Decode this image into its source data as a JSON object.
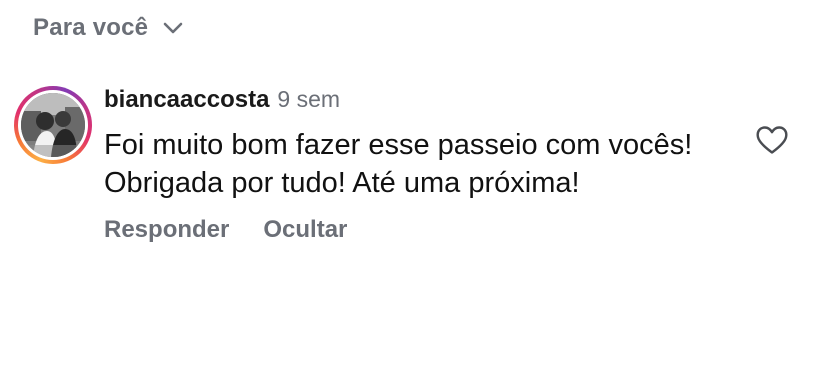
{
  "header": {
    "filter_label": "Para você",
    "filter_icon": "chevron-down-icon"
  },
  "comment": {
    "username": "biancaaccosta",
    "timestamp": "9 sem",
    "text": "Foi muito bom fazer esse passeio com vocês! Obrigada por tudo! Até uma próxima!",
    "like_icon": "heart-outline-icon",
    "actions": {
      "reply": "Responder",
      "hide": "Ocultar"
    }
  },
  "colors": {
    "muted_text": "#6b6f77",
    "primary_text": "#111111",
    "story_ring_start": "#fcaf45",
    "story_ring_mid": "#e1306c",
    "story_ring_end": "#833ab4"
  }
}
